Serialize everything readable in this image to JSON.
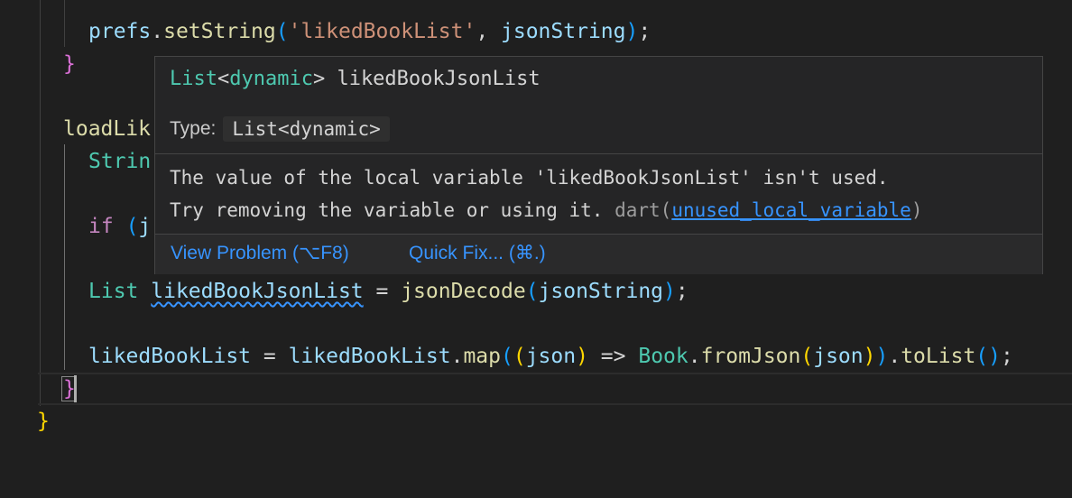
{
  "code": {
    "line1": {
      "obj": "prefs",
      "dot": ".",
      "method": "setString",
      "p1": "(",
      "str": "'likedBookList'",
      "comma": ", ",
      "arg": "jsonString",
      "p2": ")",
      "semi": ";"
    },
    "line2": {
      "brace": "}"
    },
    "line3": {
      "name": "loadLik"
    },
    "line4": {
      "type": "Strin"
    },
    "line5": {
      "kw": "if",
      "sp": " ",
      "paren": "(",
      "rest": "j"
    },
    "line6": {
      "type": "List",
      "sp": " ",
      "var": "likedBookJsonList",
      "eq": " = ",
      "fn": "jsonDecode",
      "p1": "(",
      "arg": "jsonString",
      "p2": ")",
      "semi": ";"
    },
    "line7": {
      "var": "likedBookList",
      "eq": " = ",
      "obj": "likedBookList",
      "dot": ".",
      "fn": "map",
      "p1": "(",
      "p2": "(",
      "arg": "json",
      "p3": ")",
      "arrow": " => ",
      "cls": "Book",
      "dot2": ".",
      "fn2": "fromJson",
      "p4": "(",
      "arg2": "json",
      "p5": ")",
      "p6": ")",
      "dot3": ".",
      "fn3": "toList",
      "p7": "()",
      "semi": ";"
    },
    "line8": {
      "brace": "}"
    },
    "line9": {
      "brace": "}"
    }
  },
  "hover": {
    "sig_type": "List",
    "sig_lt": "<",
    "sig_generic": "dynamic",
    "sig_gt": ">",
    "sig_name": " likedBookJsonList",
    "type_label": "Type:",
    "type_value": "List<dynamic>",
    "message_line1": "The value of the local variable 'likedBookJsonList' isn't used.",
    "message_line2": "Try removing the variable or using it. ",
    "source": "dart(",
    "code": "unused_local_variable",
    "source_close": ")",
    "action_view_problem": "View Problem (⌥F8)",
    "action_quick_fix": "Quick Fix... (⌘.)"
  },
  "colors": {
    "background": "#1f1f1f",
    "hover_background": "#252526",
    "link": "#3794ff",
    "type": "#4ec9b0",
    "string": "#ce9178",
    "function": "#dcdcaa",
    "variable": "#9cdcfe"
  }
}
